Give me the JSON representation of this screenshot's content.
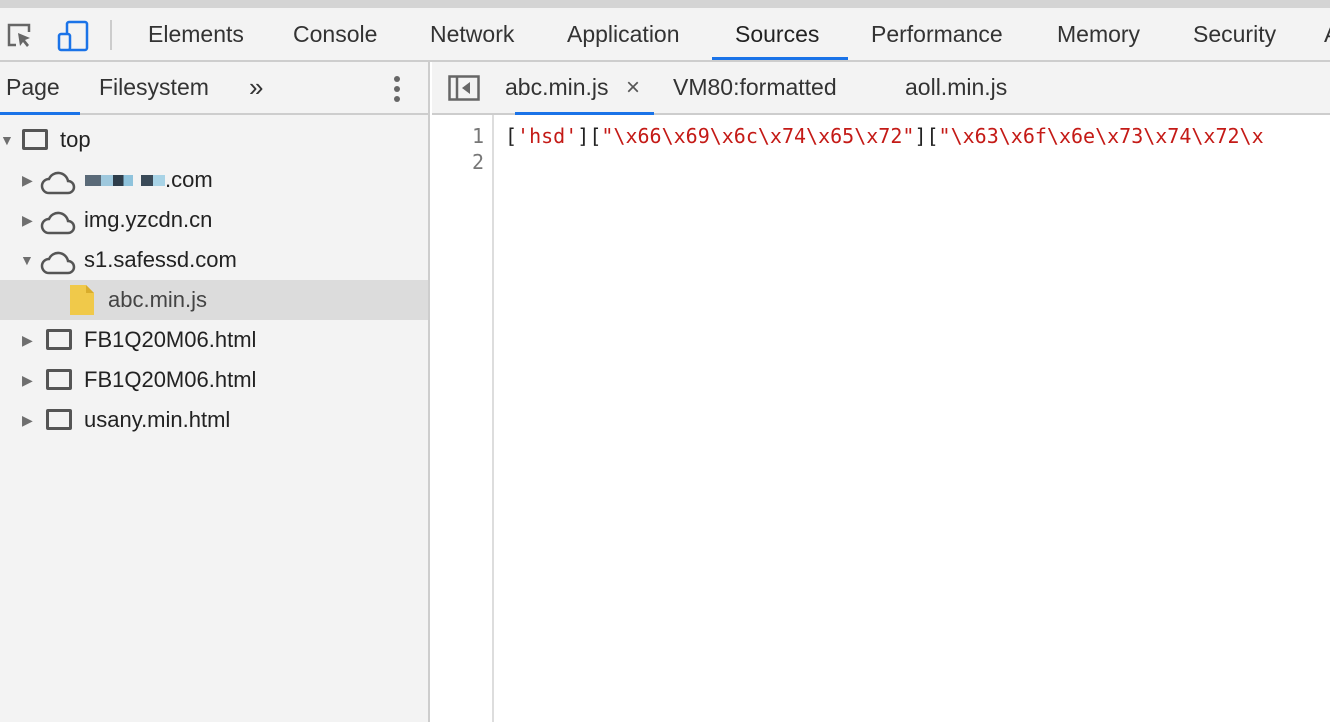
{
  "toolbar": {
    "tabs": [
      "Elements",
      "Console",
      "Network",
      "Application",
      "Sources",
      "Performance",
      "Memory",
      "Security",
      "A"
    ],
    "active_tab": "Sources",
    "accent": "#1a73e8"
  },
  "navigator": {
    "tabs": [
      "Page",
      "Filesystem"
    ],
    "more": "»",
    "active_tab": "Page",
    "tree": [
      {
        "label": "top",
        "icon": "frame-icon",
        "expanded": true
      },
      {
        "label": ".com",
        "icon": "cloud-icon",
        "expanded": false
      },
      {
        "label": "img.yzcdn.cn",
        "icon": "cloud-icon",
        "expanded": false
      },
      {
        "label": "s1.safessd.com",
        "icon": "cloud-icon",
        "expanded": true
      },
      {
        "label": "abc.min.js",
        "icon": "file-icon",
        "selected": true
      },
      {
        "label": "FB1Q20M06.html",
        "icon": "frame-icon",
        "expanded": false
      },
      {
        "label": "FB1Q20M06.html",
        "icon": "frame-icon",
        "expanded": false
      },
      {
        "label": "usany.min.html",
        "icon": "frame-icon",
        "expanded": false
      }
    ]
  },
  "editor": {
    "tabs": [
      "abc.min.js",
      "VM80:formatted",
      "aoll.min.js"
    ],
    "active_tab": "abc.min.js",
    "close": "×",
    "line_numbers": [
      "1",
      "2"
    ],
    "tokens": [
      "[",
      "'hsd'",
      "]",
      "[",
      "\"\\x66\\x69\\x6c\\x74\\x65\\x72\"",
      "]",
      "[",
      "\"\\x63\\x6f\\x6e\\x73\\x74\\x72\\x"
    ],
    "string_color": "#c41a16"
  }
}
